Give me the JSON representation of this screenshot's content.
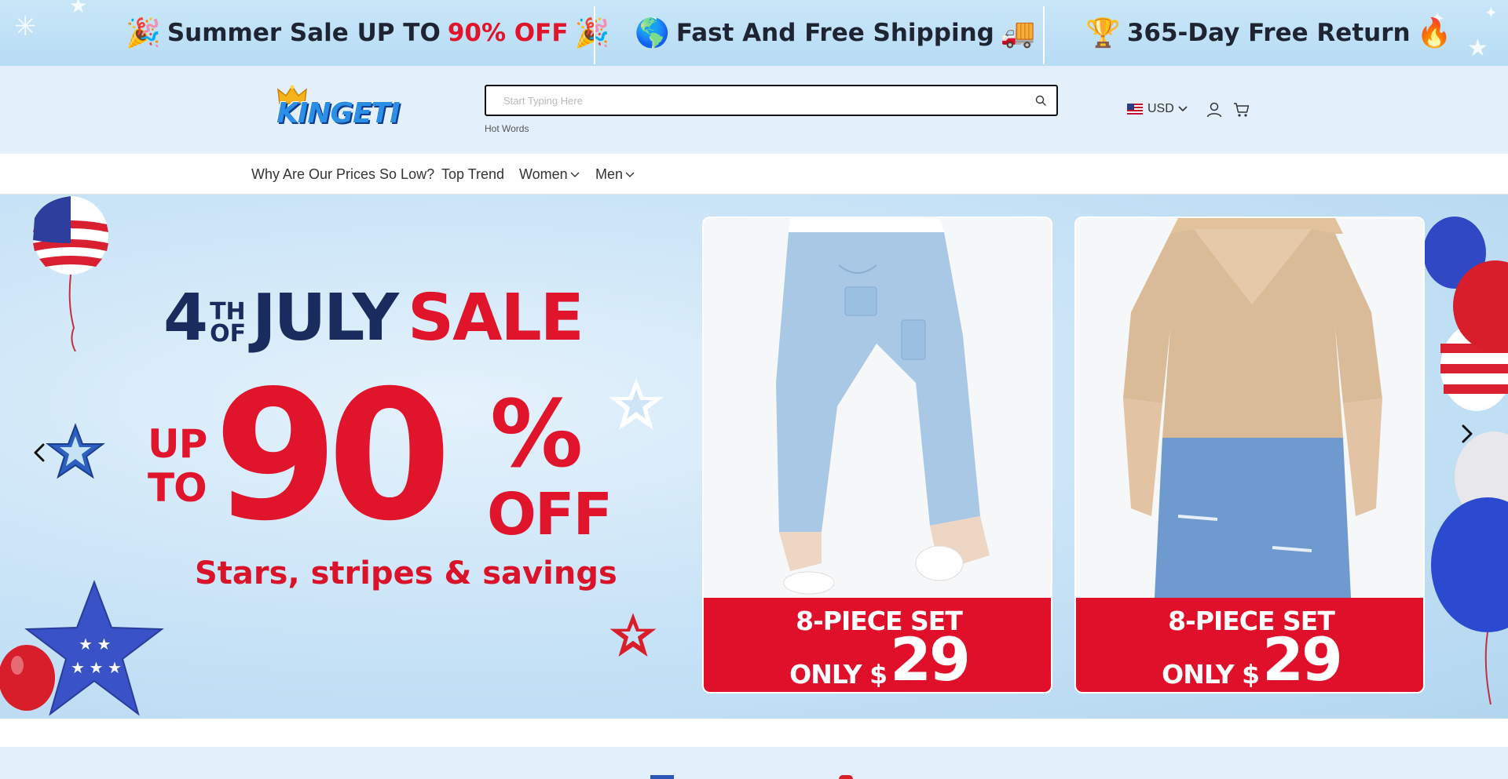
{
  "announcement": {
    "items": [
      {
        "emoji_left": "🎉",
        "text": "Summer Sale UP TO",
        "highlight": "90% OFF",
        "emoji_right": "🎉"
      },
      {
        "emoji_left": "🌎",
        "text": "Fast And Free Shipping",
        "highlight": "",
        "emoji_right": "🚚"
      },
      {
        "emoji_left": "🏆",
        "text": "365-Day Free Return",
        "highlight": "",
        "emoji_right": "🔥"
      }
    ]
  },
  "header": {
    "logo_text": "KINGETI",
    "search_placeholder": "Start Typing Here",
    "hot_words": "Hot Words",
    "currency": "USD"
  },
  "nav": {
    "items": [
      {
        "label": "Why Are Our Prices So Low?"
      },
      {
        "label": "Top Trend"
      },
      {
        "label": "Women"
      },
      {
        "label": "Men"
      }
    ]
  },
  "hero": {
    "title_num": "4",
    "title_th": "TH",
    "title_of": "OF",
    "title_july": "JULY",
    "title_sale": "SALE",
    "up": "UP",
    "to": "TO",
    "discount": "90",
    "percent": "%",
    "off": "OFF",
    "tagline": "Stars, stripes & savings",
    "cards": [
      {
        "line1": "8-PIECE SET",
        "only": "ONLY $",
        "price": "29"
      },
      {
        "line1": "8-PIECE SET",
        "only": "ONLY $",
        "price": "29"
      }
    ]
  },
  "colors": {
    "accent_red": "#e0142a",
    "navy": "#1a2b5e",
    "header_bg": "#e3f0fc",
    "announce_bg": "#c9e6f8"
  },
  "icons": [
    "search-icon",
    "us-flag-icon",
    "chevron-down-icon",
    "user-icon",
    "cart-icon",
    "arrow-left-icon",
    "arrow-right-icon"
  ]
}
